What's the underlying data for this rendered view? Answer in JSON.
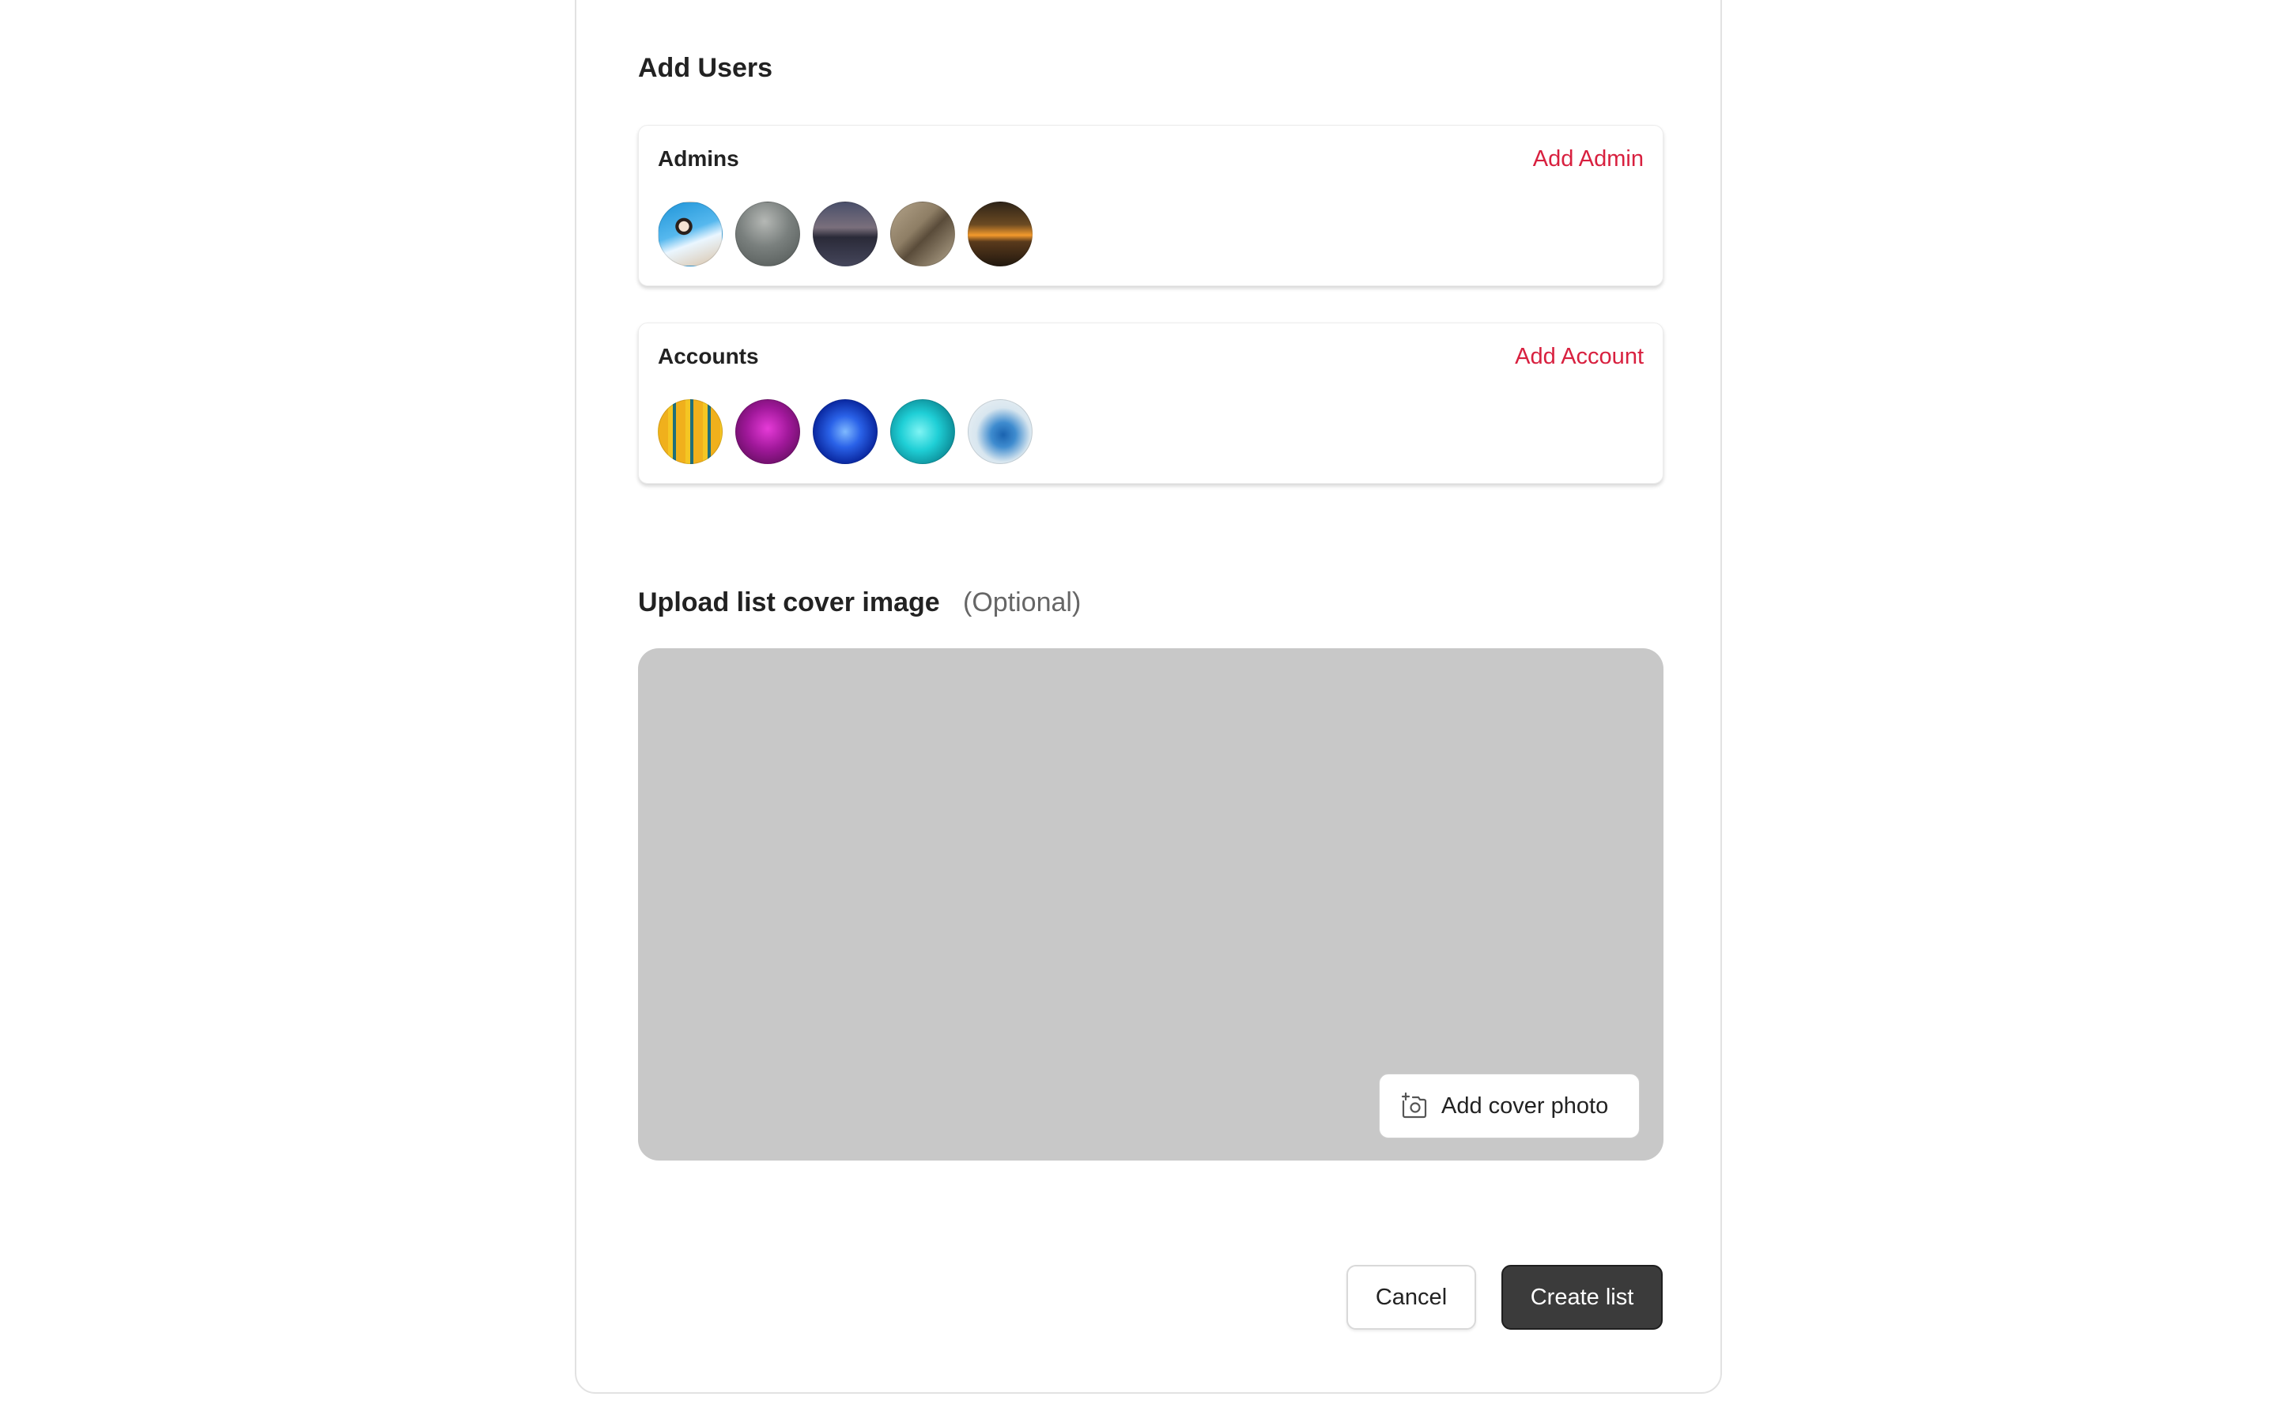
{
  "add_users": {
    "title": "Add Users",
    "admins": {
      "label": "Admins",
      "action": "Add Admin",
      "avatars": [
        "avatar-surfer",
        "avatar-cliff",
        "avatar-dusk-sea",
        "avatar-sand",
        "avatar-sunset"
      ]
    },
    "accounts": {
      "label": "Accounts",
      "action": "Add Account",
      "avatars": [
        "avatar-yellow-stripes",
        "avatar-magenta",
        "avatar-blue-burst",
        "avatar-cyan",
        "avatar-blue-splash"
      ]
    }
  },
  "cover": {
    "title": "Upload list cover image",
    "optional": "(Optional)",
    "add_photo_label": "Add cover photo",
    "add_photo_icon": "camera-add-icon"
  },
  "footer": {
    "cancel_label": "Cancel",
    "create_label": "Create list"
  },
  "colors": {
    "accent": "#d8203f",
    "cover_placeholder": "#c8c8c8",
    "primary_button": "#3b3b3b"
  }
}
